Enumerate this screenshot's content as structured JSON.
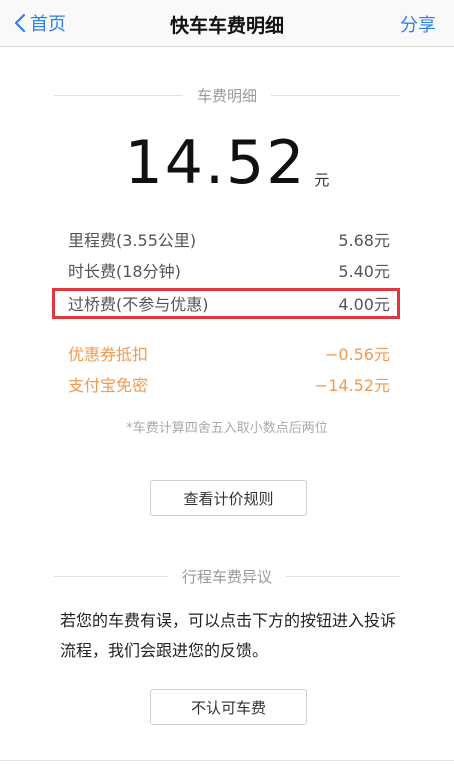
{
  "nav": {
    "back_label": "首页",
    "title": "快车车费明细",
    "share_label": "分享"
  },
  "fare": {
    "section_title": "车费明细",
    "amount": "14.52",
    "unit": "元",
    "items": [
      {
        "label": "里程费(3.55公里)",
        "value": "5.68元"
      },
      {
        "label": "时长费(18分钟)",
        "value": "5.40元"
      },
      {
        "label": "过桥费(不参与优惠)",
        "value": "4.00元"
      }
    ],
    "discounts": [
      {
        "label": "优惠券抵扣",
        "value": "−0.56元"
      },
      {
        "label": "支付宝免密",
        "value": "−14.52元"
      }
    ],
    "note": "*车费计算四舍五入取小数点后两位",
    "rules_button": "查看计价规则"
  },
  "dispute": {
    "section_title": "行程车费异议",
    "text": "若您的车费有误，可以点击下方的按钮进入投诉流程，我们会跟进您的反馈。",
    "button": "不认可车费"
  },
  "colors": {
    "link_blue": "#2f80ed",
    "discount_orange": "#f39a4f",
    "highlight_red": "#e1363e"
  }
}
